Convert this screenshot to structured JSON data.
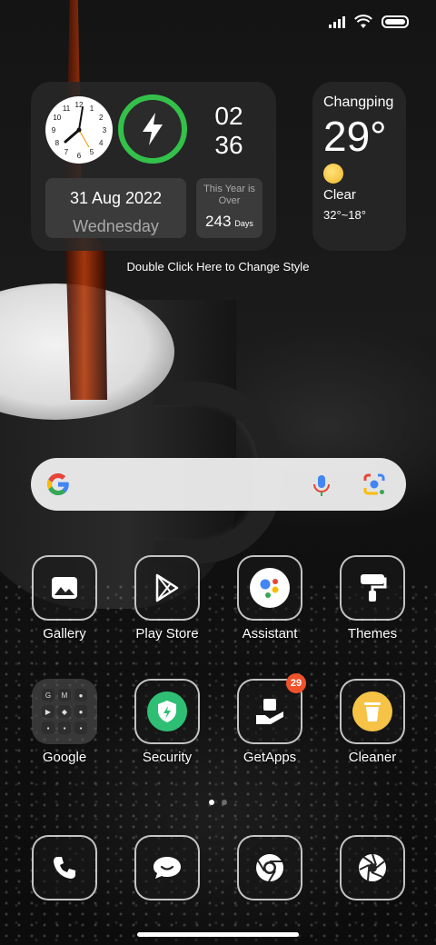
{
  "status_bar": {
    "icons": [
      "signal-icon",
      "wifi-icon",
      "battery-icon"
    ]
  },
  "clock_widget": {
    "hour": "02",
    "minute": "36",
    "date": "31 Aug 2022",
    "weekday": "Wednesday",
    "year_label": "This Year is Over",
    "days_left": "243",
    "days_unit": "Days",
    "analog_numbers": [
      "12",
      "1",
      "2",
      "3",
      "4",
      "5",
      "6",
      "7",
      "8",
      "9",
      "10",
      "11"
    ],
    "ring_color": "#33c14a"
  },
  "weather_widget": {
    "location": "Changping",
    "temperature": "29°",
    "condition": "Clear",
    "range": "32°~18°"
  },
  "hint": "Double Click Here to Change Style",
  "search_bar": {
    "icons": [
      "google-logo",
      "mic-icon",
      "lens-icon"
    ]
  },
  "apps": [
    {
      "label": "Gallery",
      "icon": "gallery-icon"
    },
    {
      "label": "Play Store",
      "icon": "play-store-icon"
    },
    {
      "label": "Assistant",
      "icon": "assistant-icon"
    },
    {
      "label": "Themes",
      "icon": "themes-icon"
    },
    {
      "label": "Google",
      "icon": "folder-icon"
    },
    {
      "label": "Security",
      "icon": "security-icon"
    },
    {
      "label": "GetApps",
      "icon": "getapps-icon",
      "badge": "29"
    },
    {
      "label": "Cleaner",
      "icon": "cleaner-icon"
    }
  ],
  "dock": [
    {
      "icon": "phone-icon"
    },
    {
      "icon": "messages-icon"
    },
    {
      "icon": "chrome-icon"
    },
    {
      "icon": "camera-icon"
    }
  ],
  "page_indicator": {
    "count": 2,
    "active": 0
  }
}
